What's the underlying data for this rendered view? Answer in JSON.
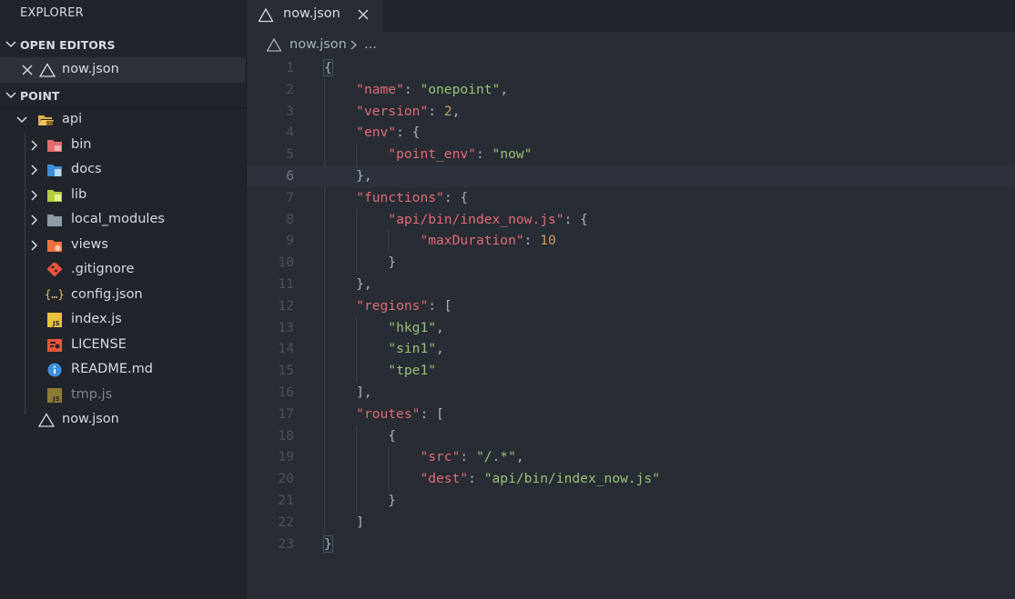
{
  "sidebar": {
    "title": "EXPLORER",
    "open_editors": {
      "label": "OPEN EDITORS",
      "items": [
        {
          "label": "now.json"
        }
      ]
    },
    "project": {
      "label": "POINT",
      "items": [
        {
          "label": "api",
          "kind": "folder-open",
          "icon": "folder-api-icon"
        },
        {
          "label": "bin",
          "kind": "folder",
          "icon": "folder-bin-icon"
        },
        {
          "label": "docs",
          "kind": "folder",
          "icon": "folder-docs-icon"
        },
        {
          "label": "lib",
          "kind": "folder",
          "icon": "folder-lib-icon"
        },
        {
          "label": "local_modules",
          "kind": "folder",
          "icon": "folder-icon"
        },
        {
          "label": "views",
          "kind": "folder",
          "icon": "folder-views-icon"
        },
        {
          "label": ".gitignore",
          "kind": "file",
          "icon": "git-icon"
        },
        {
          "label": "config.json",
          "kind": "file",
          "icon": "json-icon"
        },
        {
          "label": "index.js",
          "kind": "file",
          "icon": "js-icon"
        },
        {
          "label": "LICENSE",
          "kind": "file",
          "icon": "license-icon"
        },
        {
          "label": "README.md",
          "kind": "file",
          "icon": "info-icon"
        },
        {
          "label": "tmp.js",
          "kind": "file",
          "icon": "js-icon"
        },
        {
          "label": "now.json",
          "kind": "file",
          "icon": "now-icon"
        }
      ]
    }
  },
  "tab": {
    "label": "now.json"
  },
  "breadcrumb": {
    "file": "now.json",
    "more": "..."
  },
  "editor": {
    "lines": [
      {
        "n": "1",
        "parts": [
          [
            "p",
            "{"
          ]
        ]
      },
      {
        "n": "2",
        "parts": [
          [
            "p",
            "    "
          ],
          [
            "k",
            "\"name\""
          ],
          [
            "p",
            ": "
          ],
          [
            "s",
            "\"onepoint\""
          ],
          [
            "p",
            ","
          ]
        ]
      },
      {
        "n": "3",
        "parts": [
          [
            "p",
            "    "
          ],
          [
            "k",
            "\"version\""
          ],
          [
            "p",
            ": "
          ],
          [
            "n",
            "2"
          ],
          [
            "p",
            ","
          ]
        ]
      },
      {
        "n": "4",
        "parts": [
          [
            "p",
            "    "
          ],
          [
            "k",
            "\"env\""
          ],
          [
            "p",
            ": {"
          ]
        ]
      },
      {
        "n": "5",
        "parts": [
          [
            "p",
            "        "
          ],
          [
            "k",
            "\"point_env\""
          ],
          [
            "p",
            ": "
          ],
          [
            "s",
            "\"now\""
          ]
        ]
      },
      {
        "n": "6",
        "parts": [
          [
            "p",
            "    },"
          ]
        ]
      },
      {
        "n": "7",
        "parts": [
          [
            "p",
            "    "
          ],
          [
            "k",
            "\"functions\""
          ],
          [
            "p",
            ": {"
          ]
        ]
      },
      {
        "n": "8",
        "parts": [
          [
            "p",
            "        "
          ],
          [
            "k",
            "\"api/bin/index_now.js\""
          ],
          [
            "p",
            ": {"
          ]
        ]
      },
      {
        "n": "9",
        "parts": [
          [
            "p",
            "            "
          ],
          [
            "k",
            "\"maxDuration\""
          ],
          [
            "p",
            ": "
          ],
          [
            "n",
            "10"
          ]
        ]
      },
      {
        "n": "10",
        "parts": [
          [
            "p",
            "        }"
          ]
        ]
      },
      {
        "n": "11",
        "parts": [
          [
            "p",
            "    },"
          ]
        ]
      },
      {
        "n": "12",
        "parts": [
          [
            "p",
            "    "
          ],
          [
            "k",
            "\"regions\""
          ],
          [
            "p",
            ": ["
          ]
        ]
      },
      {
        "n": "13",
        "parts": [
          [
            "p",
            "        "
          ],
          [
            "s",
            "\"hkg1\""
          ],
          [
            "p",
            ","
          ]
        ]
      },
      {
        "n": "14",
        "parts": [
          [
            "p",
            "        "
          ],
          [
            "s",
            "\"sin1\""
          ],
          [
            "p",
            ","
          ]
        ]
      },
      {
        "n": "15",
        "parts": [
          [
            "p",
            "        "
          ],
          [
            "s",
            "\"tpe1\""
          ]
        ]
      },
      {
        "n": "16",
        "parts": [
          [
            "p",
            "    ],"
          ]
        ]
      },
      {
        "n": "17",
        "parts": [
          [
            "p",
            "    "
          ],
          [
            "k",
            "\"routes\""
          ],
          [
            "p",
            ": ["
          ]
        ]
      },
      {
        "n": "18",
        "parts": [
          [
            "p",
            "        {"
          ]
        ]
      },
      {
        "n": "19",
        "parts": [
          [
            "p",
            "            "
          ],
          [
            "k",
            "\"src\""
          ],
          [
            "p",
            ": "
          ],
          [
            "s",
            "\"/.*\""
          ],
          [
            "p",
            ","
          ]
        ]
      },
      {
        "n": "20",
        "parts": [
          [
            "p",
            "            "
          ],
          [
            "k",
            "\"dest\""
          ],
          [
            "p",
            ": "
          ],
          [
            "s",
            "\"api/bin/index_now.js\""
          ]
        ]
      },
      {
        "n": "21",
        "parts": [
          [
            "p",
            "        }"
          ]
        ]
      },
      {
        "n": "22",
        "parts": [
          [
            "p",
            "    ]"
          ]
        ]
      },
      {
        "n": "23",
        "parts": [
          [
            "p",
            "}"
          ]
        ]
      }
    ],
    "current_line": "6"
  },
  "colors": {
    "key": "#e06c75",
    "string": "#98c379",
    "number": "#d19a66",
    "punctuation": "#abb2bf",
    "background": "#282c34",
    "sidebar": "#21252b"
  }
}
